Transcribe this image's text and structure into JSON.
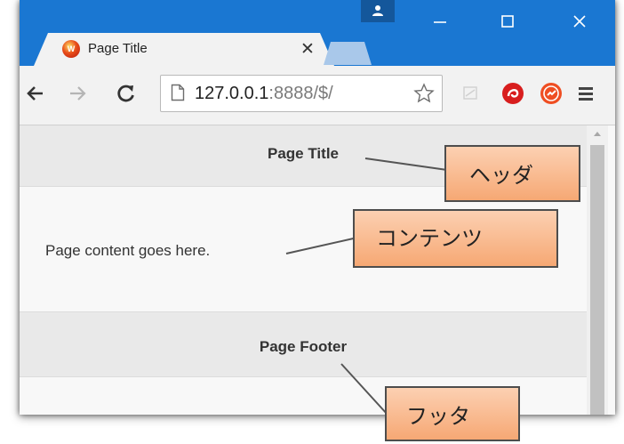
{
  "browser": {
    "tab": {
      "title": "Page Title",
      "favicon_label": "W",
      "close_glyph": "✕"
    },
    "address_bar": {
      "host": "127.0.0.1",
      "path": ":8888/$/"
    }
  },
  "page": {
    "header": "Page Title",
    "content": "Page content goes here.",
    "footer": "Page Footer"
  },
  "callouts": {
    "header": "ヘッダ",
    "content": "コンテンツ",
    "footer": "フッタ"
  },
  "icons": {
    "profile": "person-icon",
    "minimize": "minimize-icon",
    "maximize": "maximize-icon",
    "close": "close-icon",
    "back": "back-arrow-icon",
    "forward": "forward-arrow-icon",
    "reload": "reload-icon",
    "page": "page-icon",
    "bookmark": "star-icon",
    "extensions": [
      "extension-cast-icon",
      "extension-red-swirl-icon",
      "extension-orange-sync-icon"
    ],
    "menu": "hamburger-menu-icon"
  },
  "colors": {
    "titlebar": "#1a77d2",
    "profile_button": "#14579b",
    "callout_fill": "#f8b88c",
    "callout_border": "#4d4d4d"
  }
}
